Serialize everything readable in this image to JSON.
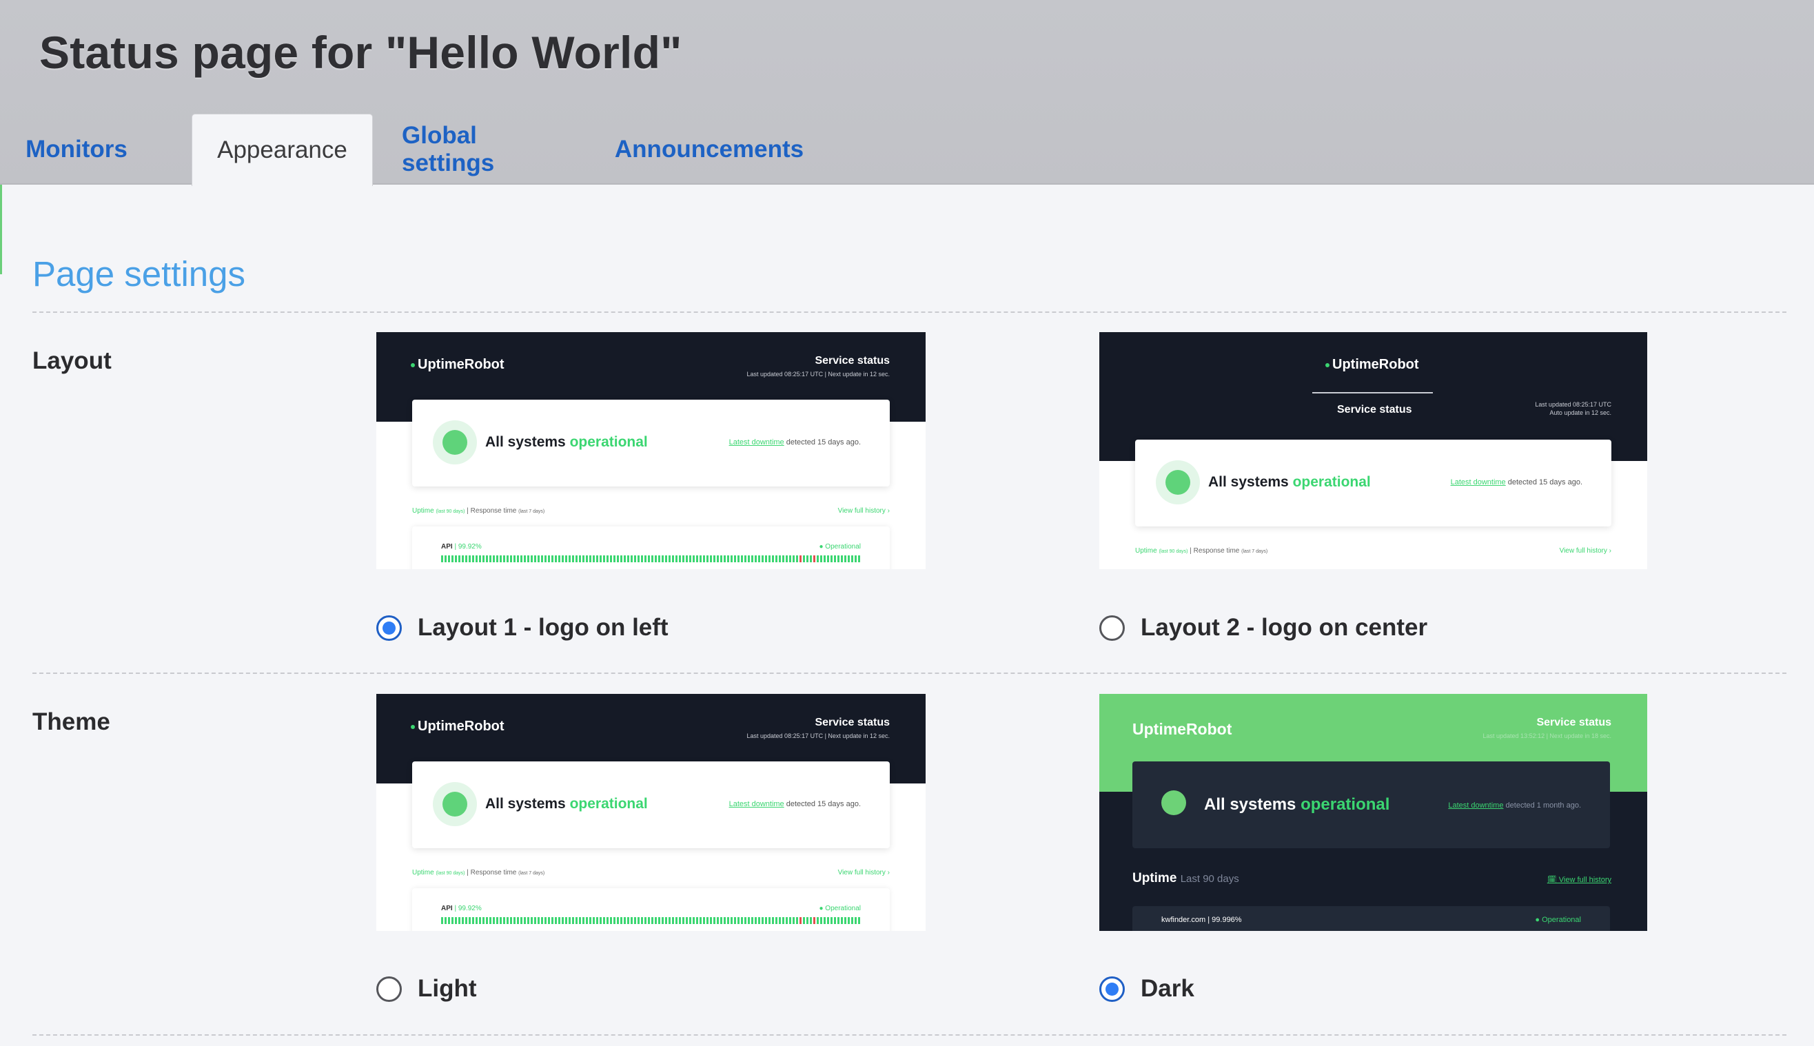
{
  "header": {
    "title": "Status page for \"Hello World\""
  },
  "tabs": [
    {
      "label": "Monitors",
      "active": false
    },
    {
      "label": "Appearance",
      "active": true
    },
    {
      "label": "Global settings",
      "active": false
    },
    {
      "label": "Announcements",
      "active": false
    }
  ],
  "section": {
    "title": "Page settings"
  },
  "layout": {
    "label": "Layout",
    "options": [
      {
        "label": "Layout 1 - logo on left",
        "checked": true
      },
      {
        "label": "Layout 2 - logo on center",
        "checked": false
      }
    ]
  },
  "theme": {
    "label": "Theme",
    "options": [
      {
        "label": "Light",
        "checked": false
      },
      {
        "label": "Dark",
        "checked": true
      }
    ]
  },
  "preview": {
    "logo": "UptimeRobot",
    "service_status": "Service status",
    "last_updated_left": "Last updated 08:25:17 UTC | Next update in 12 sec.",
    "last_updated_center_1": "Last updated 08:25:17 UTC",
    "last_updated_center_2": "Auto update in 12 sec.",
    "all_systems": "All systems",
    "operational": "operational",
    "latest_downtime": "Latest downtime",
    "detected": "detected 15 days ago.",
    "uptime": "Uptime",
    "uptime_period": "(last 90 days)",
    "response_time": "| Response time",
    "response_period": "(last 7 days)",
    "view_full_history": "View full history ›",
    "api": "API",
    "api_pct": "| 99.92%",
    "operational_status": "● Operational",
    "dark_last_updated": "Last updated 13:52:12 | Next update in 18 sec.",
    "dark_detected": "detected 1 month ago.",
    "dark_uptime": "Uptime",
    "dark_uptime_period": "Last 90 days",
    "dark_view_history": "🗓 View full history",
    "dark_monitor": "kwfinder.com | 99.996%",
    "dark_operational": "● Operational"
  },
  "colors": {
    "tab_link": "#1d62c4",
    "section_title": "#4aa0e6",
    "operational_green": "#3bd671",
    "radio_checked": "#2f7df5",
    "preview_dark": "#151a26"
  }
}
